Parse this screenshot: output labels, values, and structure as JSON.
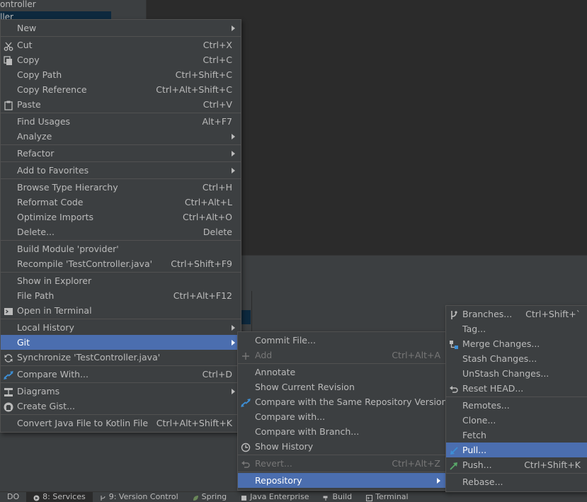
{
  "background": {
    "tree_rows": [
      "ontroller",
      "ller"
    ],
    "bottom_tabs": [
      {
        "label": "DO",
        "active": false
      },
      {
        "label": "8: Services",
        "active": true
      },
      {
        "label": "9: Version Control",
        "active": false
      },
      {
        "label": "Spring",
        "active": false
      },
      {
        "label": "Java Enterprise",
        "active": false
      },
      {
        "label": "Build",
        "active": false
      },
      {
        "label": "Terminal",
        "active": false
      }
    ]
  },
  "context_menu": {
    "new": "New",
    "cut": "Cut",
    "cut_sc": "Ctrl+X",
    "copy": "Copy",
    "copy_sc": "Ctrl+C",
    "copy_path": "Copy Path",
    "copy_path_sc": "Ctrl+Shift+C",
    "copy_reference": "Copy Reference",
    "copy_reference_sc": "Ctrl+Alt+Shift+C",
    "paste": "Paste",
    "paste_sc": "Ctrl+V",
    "find_usages": "Find Usages",
    "find_usages_sc": "Alt+F7",
    "analyze": "Analyze",
    "refactor": "Refactor",
    "add_to_favorites": "Add to Favorites",
    "browse_type_hierarchy": "Browse Type Hierarchy",
    "browse_type_hierarchy_sc": "Ctrl+H",
    "reformat_code": "Reformat Code",
    "reformat_code_sc": "Ctrl+Alt+L",
    "optimize_imports": "Optimize Imports",
    "optimize_imports_sc": "Ctrl+Alt+O",
    "delete": "Delete...",
    "delete_sc": "Delete",
    "build_module": "Build Module 'provider'",
    "recompile": "Recompile 'TestController.java'",
    "recompile_sc": "Ctrl+Shift+F9",
    "show_in_explorer": "Show in Explorer",
    "file_path": "File Path",
    "file_path_sc": "Ctrl+Alt+F12",
    "open_in_terminal": "Open in Terminal",
    "local_history": "Local History",
    "git": "Git",
    "synchronize": "Synchronize 'TestController.java'",
    "compare_with": "Compare With...",
    "compare_with_sc": "Ctrl+D",
    "diagrams": "Diagrams",
    "create_gist": "Create Gist...",
    "convert_kotlin": "Convert Java File to Kotlin File",
    "convert_kotlin_sc": "Ctrl+Alt+Shift+K"
  },
  "git_menu": {
    "commit_file": "Commit File...",
    "add": "Add",
    "add_sc": "Ctrl+Alt+A",
    "annotate": "Annotate",
    "show_current_revision": "Show Current Revision",
    "compare_same_repo": "Compare with the Same Repository Version",
    "compare_with": "Compare with...",
    "compare_with_branch": "Compare with Branch...",
    "show_history": "Show History",
    "revert": "Revert...",
    "revert_sc": "Ctrl+Alt+Z",
    "repository": "Repository"
  },
  "repository_menu": {
    "branches": "Branches...",
    "branches_sc": "Ctrl+Shift+`",
    "tag": "Tag...",
    "merge_changes": "Merge Changes...",
    "stash_changes": "Stash Changes...",
    "unstash_changes": "UnStash Changes...",
    "reset_head": "Reset HEAD...",
    "remotes": "Remotes...",
    "clone": "Clone...",
    "fetch": "Fetch",
    "pull": "Pull...",
    "push": "Push...",
    "push_sc": "Ctrl+Shift+K",
    "rebase": "Rebase..."
  },
  "colors": {
    "menu_bg": "#3c3f41",
    "selection": "#4b6eaf",
    "text": "#bbbbbb",
    "disabled": "#777777"
  }
}
